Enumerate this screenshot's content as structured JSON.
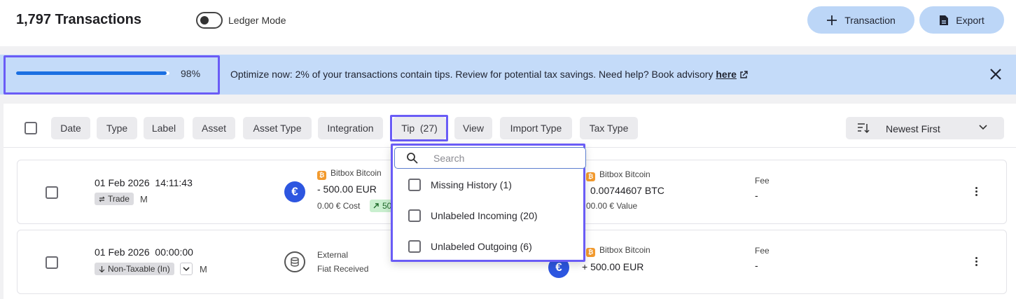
{
  "header": {
    "title": "1,797 Transactions",
    "ledger_mode_label": "Ledger Mode",
    "add_transaction_label": "Transaction",
    "export_label": "Export"
  },
  "banner": {
    "progress_percent": 98,
    "progress_text": "98%",
    "message": "Optimize now: 2% of your transactions contain tips. Review for potential tax savings. Need help? Book advisory ",
    "link_text": "here"
  },
  "filters": {
    "chips": [
      "Date",
      "Type",
      "Label",
      "Asset",
      "Asset Type",
      "Integration",
      "Tip  (27)",
      "View",
      "Import Type",
      "Tax Type"
    ],
    "sort_label": "Newest First"
  },
  "dropdown": {
    "search_placeholder": "Search",
    "options": [
      "Missing History (1)",
      "Unlabeled Incoming (20)",
      "Unlabeled Outgoing (6)"
    ]
  },
  "rows": [
    {
      "date": "01 Feb 2026",
      "time": "14:11:43",
      "type_tag": "Trade",
      "marker": "M",
      "out_source": "Bitbox Bitcoin",
      "out_amount": "- 500.00 EUR",
      "out_cost": "0.00 € Cost",
      "gain_partial": "50",
      "in_source": "Bitbox Bitcoin",
      "in_amount": "0.00744607 BTC",
      "in_value": "00.00 € Value",
      "fee_label": "Fee",
      "fee_value": "-"
    },
    {
      "date": "01 Feb 2026",
      "time": "00:00:00",
      "type_tag": "Non-Taxable (In)",
      "marker": "M",
      "out_source": "External",
      "out_sub": "Fiat Received",
      "in_source": "Bitbox Bitcoin",
      "in_amount": "+ 500.00 EUR",
      "fee_label": "Fee",
      "fee_value": "-"
    }
  ],
  "colors": {
    "accent_blue": "#1b6fe2",
    "banner_bg": "#c4dbf9",
    "button_bg": "#bcd6f7",
    "highlight": "#6a5cf6",
    "btc_orange": "#f29a2e",
    "euro_blue": "#2d56e0"
  },
  "icons": [
    "plus-icon",
    "document-icon",
    "external-link-icon",
    "close-icon",
    "sort-icon",
    "chevron-down-icon",
    "search-icon",
    "bitcoin-icon",
    "euro-icon",
    "coin-stack-icon",
    "swap-icon",
    "arrow-down-icon",
    "trend-up-icon",
    "kebab-icon"
  ]
}
